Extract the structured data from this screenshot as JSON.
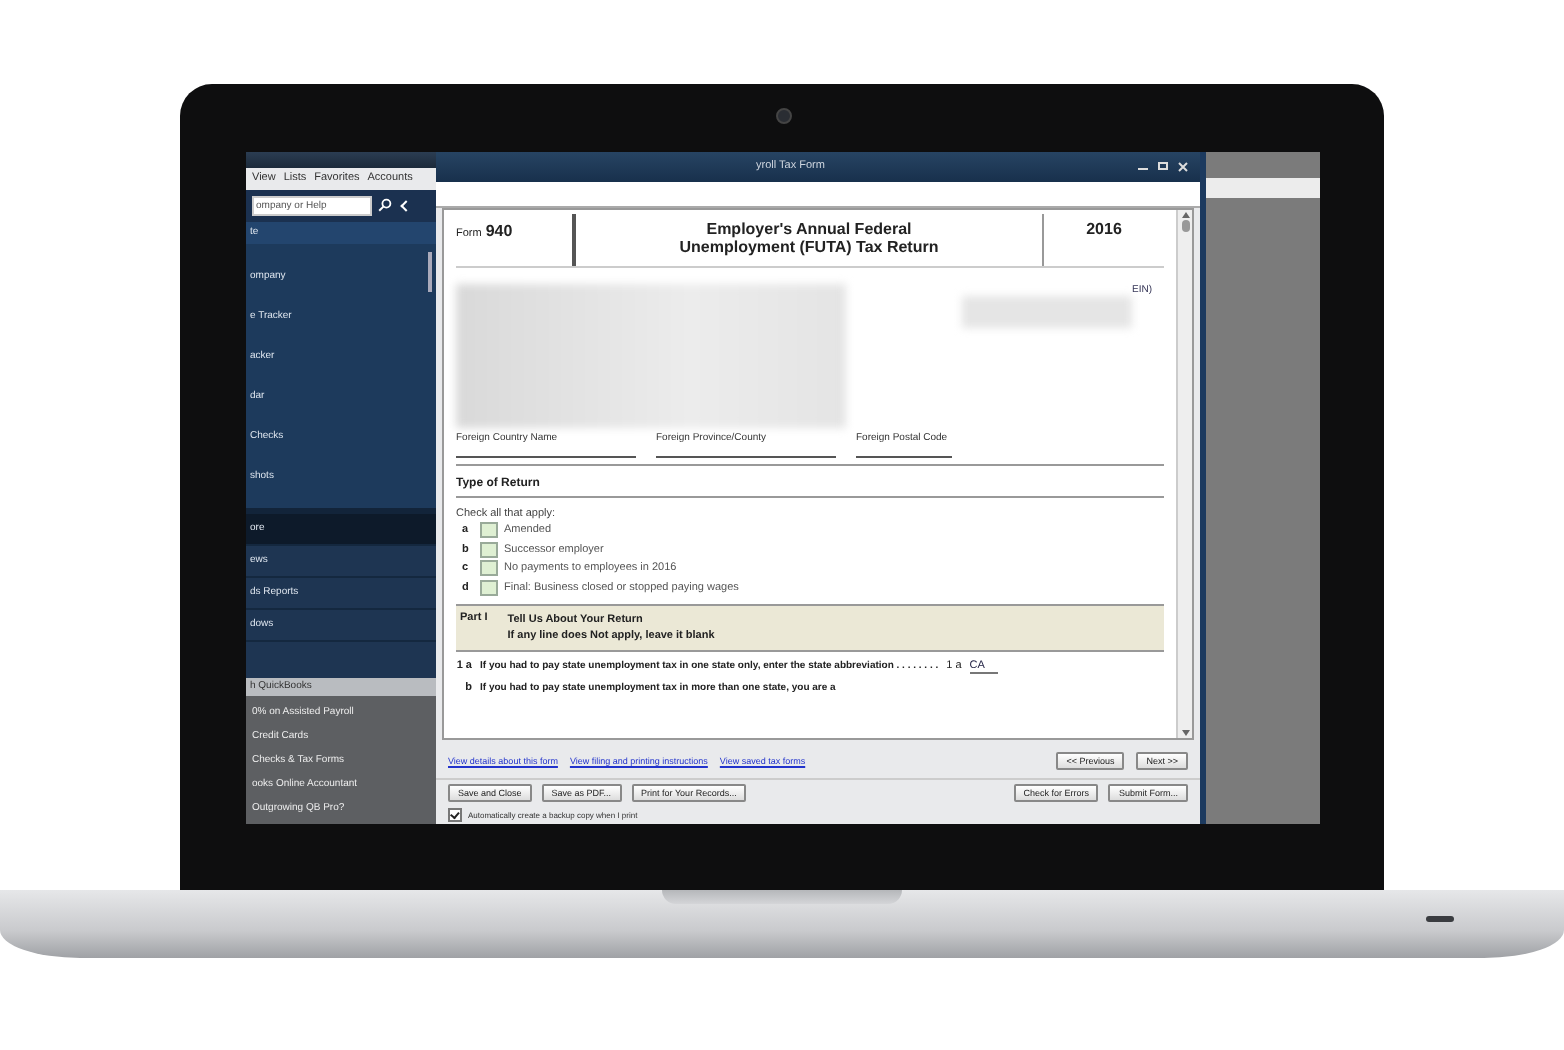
{
  "app_menu": [
    "View",
    "Lists",
    "Favorites",
    "Accounts"
  ],
  "sidebar": {
    "search": {
      "placeholder": "ompany or Help"
    },
    "heading": "te",
    "items": [
      {
        "label": "ompany",
        "selected": false
      },
      {
        "label": "e Tracker",
        "selected": false
      },
      {
        "label": "acker",
        "selected": false
      },
      {
        "label": "dar",
        "selected": false
      },
      {
        "label": "Checks",
        "selected": false
      },
      {
        "label": "shots",
        "selected": false
      }
    ],
    "section_items": [
      {
        "label": "ore",
        "selected": true
      },
      {
        "label": "ews",
        "selected": false
      },
      {
        "label": "ds Reports",
        "selected": false
      },
      {
        "label": "dows",
        "selected": false
      }
    ],
    "promo_heading": "h QuickBooks",
    "promo_items": [
      "0% on Assisted Payroll",
      "Credit Cards",
      "Checks & Tax Forms",
      "ooks Online Accountant",
      "Outgrowing QB Pro?"
    ]
  },
  "form_window": {
    "title": "yroll Tax Form",
    "form": {
      "form_label": "Form",
      "form_number": "940",
      "title_lines": [
        "Employer's Annual Federal",
        "Unemployment (FUTA) Tax Return"
      ],
      "year": "2016",
      "ein_label": "EIN)",
      "foreign_fields": [
        "Foreign Country Name",
        "Foreign Province/County",
        "Foreign Postal Code"
      ],
      "section_title": "Type of Return",
      "check_prompt": "Check all that apply:",
      "return_types": [
        {
          "letter": "a",
          "label": "Amended",
          "checked": false
        },
        {
          "letter": "b",
          "label": "Successor employer",
          "checked": false
        },
        {
          "letter": "c",
          "label": "No payments to employees in 2016",
          "checked": false
        },
        {
          "letter": "d",
          "label": "Final: Business closed or stopped paying wages",
          "checked": false
        }
      ],
      "part": {
        "number": "Part I",
        "title": "Tell Us About Your Return",
        "subtitle": "If any line does Not apply, leave it blank"
      },
      "lines": [
        {
          "number": "1 a",
          "text": "If you had to pay state unemployment tax in one state only, enter the state abbreviation . . . . . . . .",
          "field_label": "1 a",
          "value": "CA"
        },
        {
          "number": "b",
          "text": "If you had to pay state unemployment tax in more than one state, you are a"
        }
      ]
    },
    "links": [
      "View details about this form",
      "View filing and printing instructions",
      "View saved tax forms"
    ],
    "nav_buttons": [
      "<< Previous",
      "Next >>"
    ],
    "action_buttons": [
      "Save and Close",
      "Save as PDF...",
      "Print for Your Records..."
    ],
    "right_buttons": [
      "Check for Errors",
      "Submit Form..."
    ],
    "backup_option": {
      "label": "Automatically create a backup copy when I print",
      "checked": true
    }
  }
}
